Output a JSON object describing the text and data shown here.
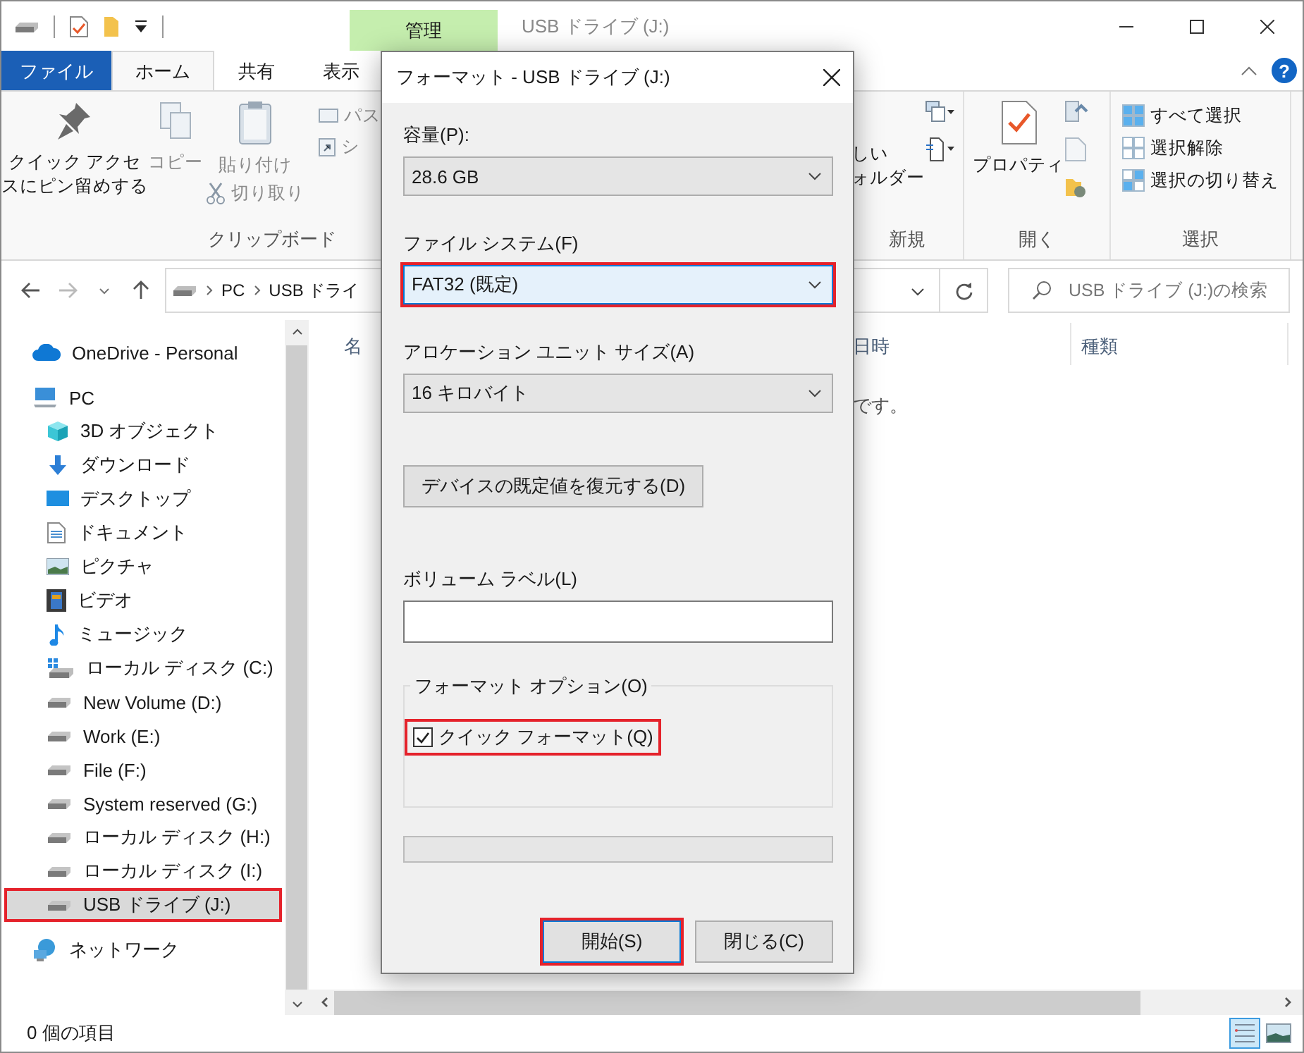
{
  "window": {
    "title": "USB ドライブ (J:)",
    "context_tab": "管理"
  },
  "ribbon_tabs": [
    {
      "label": "ファイル",
      "kind": "file",
      "selected": false
    },
    {
      "label": "ホーム",
      "kind": "tab",
      "selected": true
    },
    {
      "label": "共有",
      "kind": "tab",
      "selected": false
    },
    {
      "label": "表示",
      "kind": "tab",
      "selected": false
    }
  ],
  "help": "?",
  "ribbon": {
    "clipboard": {
      "label": "クリップボード",
      "pin": {
        "lines": [
          "クイック アクセ",
          "スにピン留めする"
        ],
        "disabled": false
      },
      "copy": {
        "label": "コピー",
        "disabled": true
      },
      "paste": {
        "label": "貼り付け",
        "disabled": true
      },
      "cut": {
        "label": "切り取り",
        "disabled": true
      },
      "path": {
        "label": "パス",
        "disabled": true
      },
      "shortcut": {
        "label": "シ",
        "disabled": true
      }
    },
    "new": {
      "label": "新規",
      "folder_lines": [
        "しい",
        "ォルダー"
      ]
    },
    "open": {
      "label": "開く",
      "properties": "プロパティ"
    },
    "select": {
      "label": "選択",
      "items": [
        {
          "label": "すべて選択",
          "kind": "all"
        },
        {
          "label": "選択解除",
          "kind": "none"
        },
        {
          "label": "選択の切り替え",
          "kind": "invert"
        }
      ]
    }
  },
  "address": {
    "crumbs": [
      "PC",
      "USB ドライ"
    ]
  },
  "search": {
    "placeholder": "USB ドライブ (J:)の検索"
  },
  "nav": {
    "items": [
      {
        "label": "OneDrive - Personal",
        "kind": "cloud",
        "selected": false,
        "highlighted": false
      },
      {
        "label": "PC",
        "kind": "pc",
        "selected": false,
        "highlighted": false,
        "children": [
          {
            "label": "3D オブジェクト",
            "kind": "cube",
            "selected": false,
            "highlighted": false
          },
          {
            "label": "ダウンロード",
            "kind": "download",
            "selected": false,
            "highlighted": false
          },
          {
            "label": "デスクトップ",
            "kind": "desktop",
            "selected": false,
            "highlighted": false
          },
          {
            "label": "ドキュメント",
            "kind": "document",
            "selected": false,
            "highlighted": false
          },
          {
            "label": "ピクチャ",
            "kind": "pictures",
            "selected": false,
            "highlighted": false
          },
          {
            "label": "ビデオ",
            "kind": "video",
            "selected": false,
            "highlighted": false
          },
          {
            "label": "ミュージック",
            "kind": "music",
            "selected": false,
            "highlighted": false
          },
          {
            "label": "ローカル ディスク (C:)",
            "kind": "system-drive",
            "selected": false,
            "highlighted": false
          },
          {
            "label": "New Volume (D:)",
            "kind": "drive",
            "selected": false,
            "highlighted": false
          },
          {
            "label": "Work (E:)",
            "kind": "drive",
            "selected": false,
            "highlighted": false
          },
          {
            "label": "File (F:)",
            "kind": "drive",
            "selected": false,
            "highlighted": false
          },
          {
            "label": "System reserved (G:)",
            "kind": "drive",
            "selected": false,
            "highlighted": false
          },
          {
            "label": "ローカル ディスク (H:)",
            "kind": "drive",
            "selected": false,
            "highlighted": false
          },
          {
            "label": "ローカル ディスク (I:)",
            "kind": "drive",
            "selected": false,
            "highlighted": false
          },
          {
            "label": "USB ドライブ (J:)",
            "kind": "drive",
            "selected": true,
            "highlighted": true
          }
        ]
      },
      {
        "label": "ネットワーク",
        "kind": "network",
        "selected": false,
        "highlighted": false
      }
    ]
  },
  "content": {
    "columns": [
      "名",
      "日時",
      "種類"
    ],
    "empty_message": "です。"
  },
  "status_bar": {
    "item_count": "0 個の項目",
    "views": [
      {
        "kind": "details",
        "selected": true
      },
      {
        "kind": "large-icons",
        "selected": false
      }
    ]
  },
  "dialog": {
    "title": "フォーマット - USB ドライブ (J:)",
    "fields": [
      {
        "kind": "combo",
        "label": "容量(P):",
        "value": "28.6 GB",
        "focused": false,
        "highlighted": false
      },
      {
        "kind": "combo",
        "label": "ファイル システム(F)",
        "value": "FAT32 (既定)",
        "focused": true,
        "highlighted": true
      },
      {
        "kind": "combo",
        "label": "アロケーション ユニット サイズ(A)",
        "value": "16 キロバイト",
        "focused": false,
        "highlighted": false
      },
      {
        "kind": "button",
        "label": "デバイスの既定値を復元する(D)"
      },
      {
        "kind": "text",
        "label": "ボリューム ラベル(L)"
      }
    ],
    "options": {
      "label": "フォーマット オプション(O)",
      "checkbox": {
        "label": "クイック フォーマット(Q)",
        "checked": true,
        "highlighted": true
      }
    },
    "progress": {
      "level": 0
    },
    "buttons": [
      {
        "label": "開始(S)",
        "default": true,
        "highlighted": true
      },
      {
        "label": "閉じる(C)",
        "default": false,
        "highlighted": false
      }
    ]
  }
}
